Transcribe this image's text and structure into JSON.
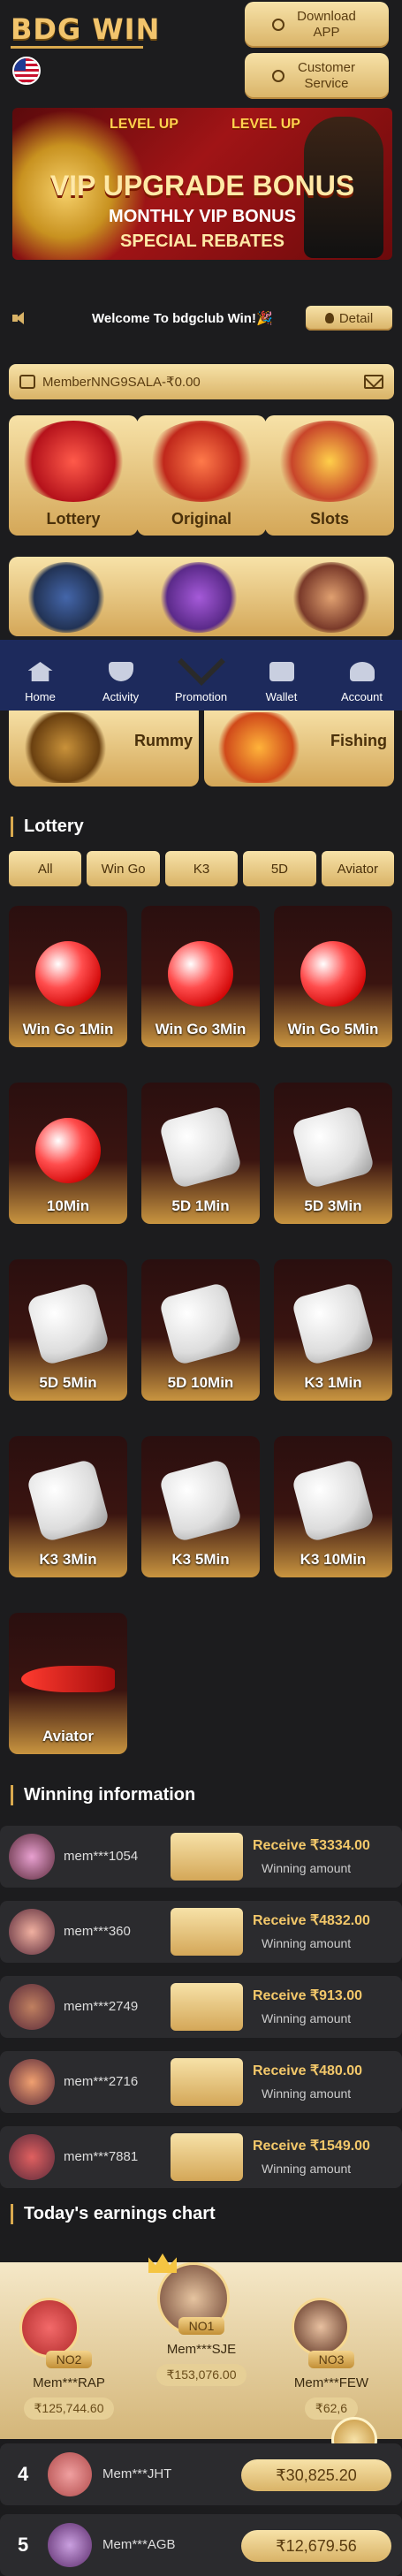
{
  "header": {
    "logo": "BDG WIN",
    "download_label": "Download APP",
    "service_label": "Customer Service"
  },
  "banner": {
    "level_left": "LEVEL UP",
    "level_right": "LEVEL UP",
    "title": "VIP UPGRADE BONUS",
    "line2": "MONTHLY VIP BONUS",
    "line3": "SPECIAL REBATES"
  },
  "notice": {
    "text": "Welcome To bdgclub Win!🎉",
    "detail_label": "Detail"
  },
  "member": {
    "text": "MemberNNG9SALA-₹0.00"
  },
  "categories": {
    "row1": [
      {
        "label": "Lottery"
      },
      {
        "label": "Original"
      },
      {
        "label": "Slots"
      }
    ],
    "row3": [
      {
        "label": "Rummy"
      },
      {
        "label": "Fishing"
      }
    ]
  },
  "nav": {
    "items": [
      {
        "label": "Home"
      },
      {
        "label": "Activity"
      },
      {
        "label": "Promotion"
      },
      {
        "label": "Wallet"
      },
      {
        "label": "Account"
      }
    ]
  },
  "lottery": {
    "title": "Lottery",
    "tabs": [
      "All",
      "Win Go",
      "K3",
      "5D",
      "Aviator"
    ],
    "games": [
      {
        "label": "Win Go 1Min",
        "art": "wingo"
      },
      {
        "label": "Win Go 3Min",
        "art": "wingo"
      },
      {
        "label": "Win Go 5Min",
        "art": "wingo"
      },
      {
        "label": "10Min",
        "art": "wingo"
      },
      {
        "label": "5D 1Min",
        "art": "dice"
      },
      {
        "label": "5D 3Min",
        "art": "dice"
      },
      {
        "label": "5D 5Min",
        "art": "dice"
      },
      {
        "label": "5D 10Min",
        "art": "dice"
      },
      {
        "label": "K3 1Min",
        "art": "k3"
      },
      {
        "label": "K3 3Min",
        "art": "k3"
      },
      {
        "label": "K3 5Min",
        "art": "k3"
      },
      {
        "label": "K3 10Min",
        "art": "k3"
      },
      {
        "label": "Aviator",
        "art": "plane"
      }
    ]
  },
  "winning": {
    "title": "Winning information",
    "amount_label": "Winning amount",
    "items": [
      {
        "name": "mem***1054",
        "receive": "Receive ₹3334.00"
      },
      {
        "name": "mem***360",
        "receive": "Receive ₹4832.00"
      },
      {
        "name": "mem***2749",
        "receive": "Receive ₹913.00"
      },
      {
        "name": "mem***2716",
        "receive": "Receive ₹480.00"
      },
      {
        "name": "mem***7881",
        "receive": "Receive ₹1549.00"
      }
    ]
  },
  "earnings": {
    "title": "Today's earnings chart",
    "podium": [
      {
        "badge": "NO2",
        "name": "Mem***RAP",
        "amount": "₹125,744.60"
      },
      {
        "badge": "NO1",
        "name": "Mem***SJE",
        "amount": "₹153,076.00"
      },
      {
        "badge": "NO3",
        "name": "Mem***FEW",
        "amount": "₹62,6"
      }
    ],
    "ranks": [
      {
        "num": "4",
        "name": "Mem***JHT",
        "amount": "₹30,825.20"
      },
      {
        "num": "5",
        "name": "Mem***AGB",
        "amount": "₹12,679.56"
      }
    ]
  },
  "colors": {
    "gold": "#d9b367",
    "background": "#1c1c1e",
    "nav": "#1d2a5c"
  }
}
